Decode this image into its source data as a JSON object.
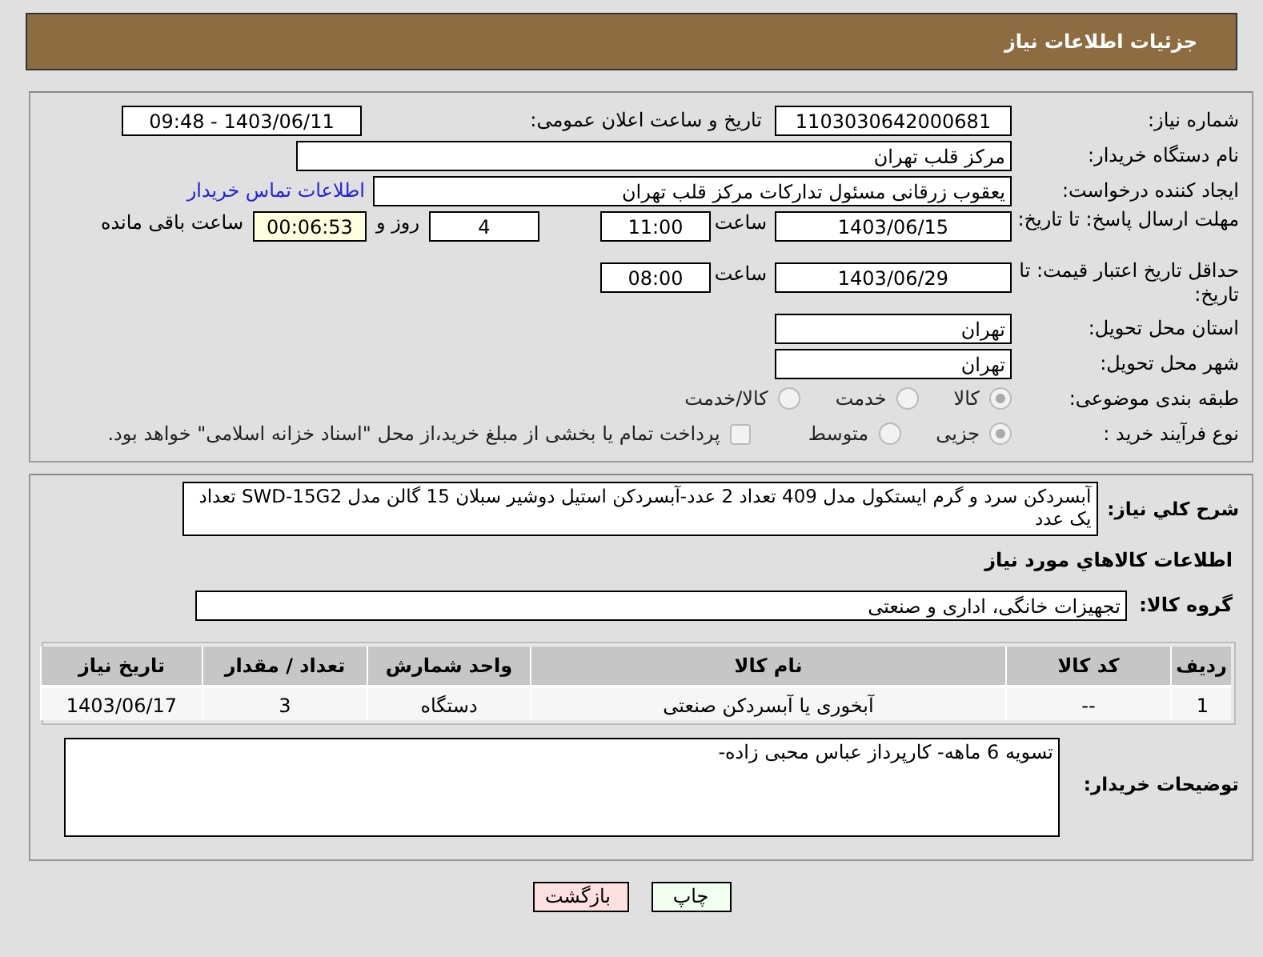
{
  "header": {
    "title": "جزئیات اطلاعات نیاز"
  },
  "need_number": {
    "label": "شماره نیاز:",
    "value": "1103030642000681"
  },
  "announce": {
    "label": "تاریخ و ساعت اعلان عمومی:",
    "value": "1403/06/11 - 09:48"
  },
  "buyer_org": {
    "label": "نام دستگاه خریدار:",
    "value": "مرکز قلب تهران"
  },
  "requester": {
    "label": "ایجاد کننده درخواست:",
    "value": "یعقوب زرقانی مسئول تدارکات مرکز قلب تهران",
    "link": "اطلاعات تماس خریدار"
  },
  "deadline": {
    "label": "مهلت ارسال پاسخ: تا تاریخ:",
    "date": "1403/06/15",
    "time_label": "ساعت",
    "time": "11:00",
    "days": "4",
    "days_label": "روز و",
    "remaining": "00:06:53",
    "remaining_label": "ساعت باقی مانده"
  },
  "validity": {
    "label": "حداقل تاریخ اعتبار قیمت: تا تاریخ:",
    "date": "1403/06/29",
    "time_label": "ساعت",
    "time": "08:00"
  },
  "province": {
    "label": "استان محل تحویل:",
    "value": "تهران"
  },
  "city": {
    "label": "شهر محل تحویل:",
    "value": "تهران"
  },
  "category": {
    "label": "طبقه بندی موضوعی:",
    "options": [
      {
        "label": "کالا",
        "selected": true
      },
      {
        "label": "خدمت",
        "selected": false
      },
      {
        "label": "کالا/خدمت",
        "selected": false
      }
    ]
  },
  "process": {
    "label": "نوع فرآیند خرید :",
    "options": [
      {
        "label": "جزیی",
        "selected": true
      },
      {
        "label": "متوسط",
        "selected": false
      }
    ],
    "payment": {
      "label": "پرداخت تمام یا بخشی از مبلغ خرید،از محل \"اسناد خزانه اسلامی\" خواهد بود.",
      "checked": false
    }
  },
  "description": {
    "label": "شرح كلي نياز:",
    "value": "آبسردکن سرد و گرم ایستکول مدل 409 تعداد 2 عدد-آبسردکن استیل دوشیر سبلان 15 گالن مدل SWD-15G2 تعداد یک عدد"
  },
  "goods_title": "اطلاعات كالاهاي مورد نياز",
  "group": {
    "label": "گروه کالا:",
    "value": "تجهیزات خانگی، اداری و صنعتی"
  },
  "table": {
    "columns": [
      "ردیف",
      "کد کالا",
      "نام کالا",
      "واحد شمارش",
      "تعداد / مقدار",
      "تاریخ نیاز"
    ],
    "rows": [
      [
        "1",
        "--",
        "آبخوری یا آبسردکن صنعتی",
        "دستگاه",
        "3",
        "1403/06/17"
      ]
    ]
  },
  "buyer_notes": {
    "label": "توضیحات خریدار:",
    "value": "تسویه 6 ماهه- کارپرداز عباس محبی زاده-"
  },
  "buttons": [
    {
      "label": "چاپ",
      "kind": "print"
    },
    {
      "label": "بازگشت",
      "kind": "back"
    }
  ]
}
